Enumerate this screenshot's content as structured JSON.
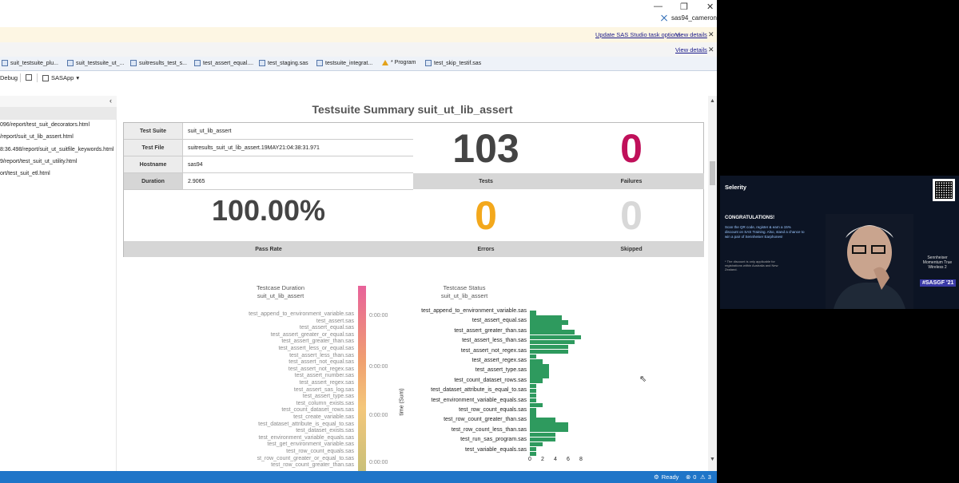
{
  "titlebar": {
    "user": "sas94_cameron"
  },
  "notifications": {
    "task_options_link": "Update SAS Studio task options",
    "view_details_1": "View details",
    "view_details_2": "View details"
  },
  "tabs": [
    {
      "label": "suit_testsuite_plu..."
    },
    {
      "label": "suit_testsuite_ut_..."
    },
    {
      "label": "suitresults_test_s..."
    },
    {
      "label": "test_assert_equal...."
    },
    {
      "label": "test_staging.sas"
    },
    {
      "label": "testsuite_integrat..."
    },
    {
      "label": "* Program"
    },
    {
      "label": "test_skip_testif.sas"
    }
  ],
  "toolbar": {
    "debug": "Debug",
    "server": "SASApp"
  },
  "left_panel": {
    "files": [
      "096/report/test_suit_decorators.html",
      "/report/suit_ut_lib_assert.html",
      "8:36.498/report/suit_ut_suitfile_keywords.html",
      "9/report/test_suit_ut_utility.html",
      "ort/test_suit_etl.html"
    ]
  },
  "report": {
    "title": "Testsuite Summary suit_ut_lib_assert",
    "rows": [
      {
        "label": "Test Suite",
        "value": "suit_ut_lib_assert"
      },
      {
        "label": "Test File",
        "value": "suitresults_suit_ut_lib_assert.19MAY21:04:38:31.971"
      },
      {
        "label": "Hostname",
        "value": "sas94"
      },
      {
        "label": "Duration",
        "value": "2.9065"
      }
    ],
    "tests": {
      "value": "103",
      "label": "Tests"
    },
    "failures": {
      "value": "0",
      "label": "Failures"
    },
    "pass_rate": {
      "value": "100.00%",
      "label": "Pass Rate"
    },
    "errors": {
      "value": "0",
      "label": "Errors"
    },
    "skipped": {
      "value": "0",
      "label": "Skipped"
    },
    "colors": {
      "tests": "#444444",
      "failures": "#c0105a",
      "errors": "#f3a81c",
      "skipped": "#d8d8d8"
    }
  },
  "duration_chart": {
    "title": "Testcase Duration",
    "subtitle": "suit_ut_lib_assert",
    "colorbar_title": "time (Sum)",
    "colorbar_ticks": [
      "0:00:00",
      "0:00:00",
      "0:00:00",
      "0:00:00"
    ],
    "colormap": [
      "#e8629a",
      "#f0a070",
      "#f4c77a",
      "#c8c079"
    ],
    "labels": [
      "test_append_to_environment_variable.sas",
      "test_assert.sas",
      "test_assert_equal.sas",
      "test_assert_greater_or_equal.sas",
      "test_assert_greater_than.sas",
      "test_assert_less_or_equal.sas",
      "test_assert_less_than.sas",
      "test_assert_not_equal.sas",
      "test_assert_not_regex.sas",
      "test_assert_number.sas",
      "test_assert_regex.sas",
      "test_assert_sas_log.sas",
      "test_assert_type.sas",
      "test_column_exists.sas",
      "test_count_dataset_rows.sas",
      "test_create_variable.sas",
      "test_dataset_attribute_is_equal_to.sas",
      "test_dataset_exists.sas",
      "test_environment_variable_equals.sas",
      "test_get_environment_variable.sas",
      "test_row_count_equals.sas",
      "st_row_count_greater_or_equal_to.sas",
      "test_row_count_greater_than.sas"
    ]
  },
  "chart_data": {
    "type": "bar",
    "orientation": "horizontal",
    "title": "Testcase Status",
    "subtitle": "suit_ut_lib_assert",
    "categories_labeled": [
      "test_append_to_environment_variable.sas",
      "test_assert_equal.sas",
      "test_assert_greater_than.sas",
      "test_assert_less_than.sas",
      "test_assert_not_regex.sas",
      "test_assert_regex.sas",
      "test_assert_type.sas",
      "test_count_dataset_rows.sas",
      "test_dataset_attribute_is_equal_to.sas",
      "test_environment_variable_equals.sas",
      "test_row_count_equals.sas",
      "test_row_count_greater_than.sas",
      "test_row_count_less_than.sas",
      "test_run_sas_program.sas",
      "test_variable_equals.sas"
    ],
    "values": [
      1,
      5,
      6,
      5,
      7,
      8,
      7,
      6,
      6,
      1,
      2,
      3,
      3,
      3,
      2,
      1,
      1,
      1,
      1,
      2,
      1,
      1,
      4,
      6,
      6,
      4,
      4,
      2,
      1,
      1
    ],
    "xlim": [
      0,
      8
    ],
    "xticks": [
      "0",
      "2",
      "4",
      "6",
      "8"
    ],
    "color": "#2e9a5e"
  },
  "status_bar": {
    "ready": "Ready",
    "errors": "0",
    "warnings": "3"
  },
  "video": {
    "brand": "Selerity",
    "congrats": "CONGRATULATIONS!",
    "text": "Scan the QR code, register & earn a 15% discount on SAS Training. Also, stand a chance to win a pair of Sennheiser Earphones!",
    "note": "* The discount is only applicable for registrations within Australia and New Zealand.",
    "product": "Sennheiser Momentum True Wireless 2",
    "tag": "#SASGF '21"
  }
}
